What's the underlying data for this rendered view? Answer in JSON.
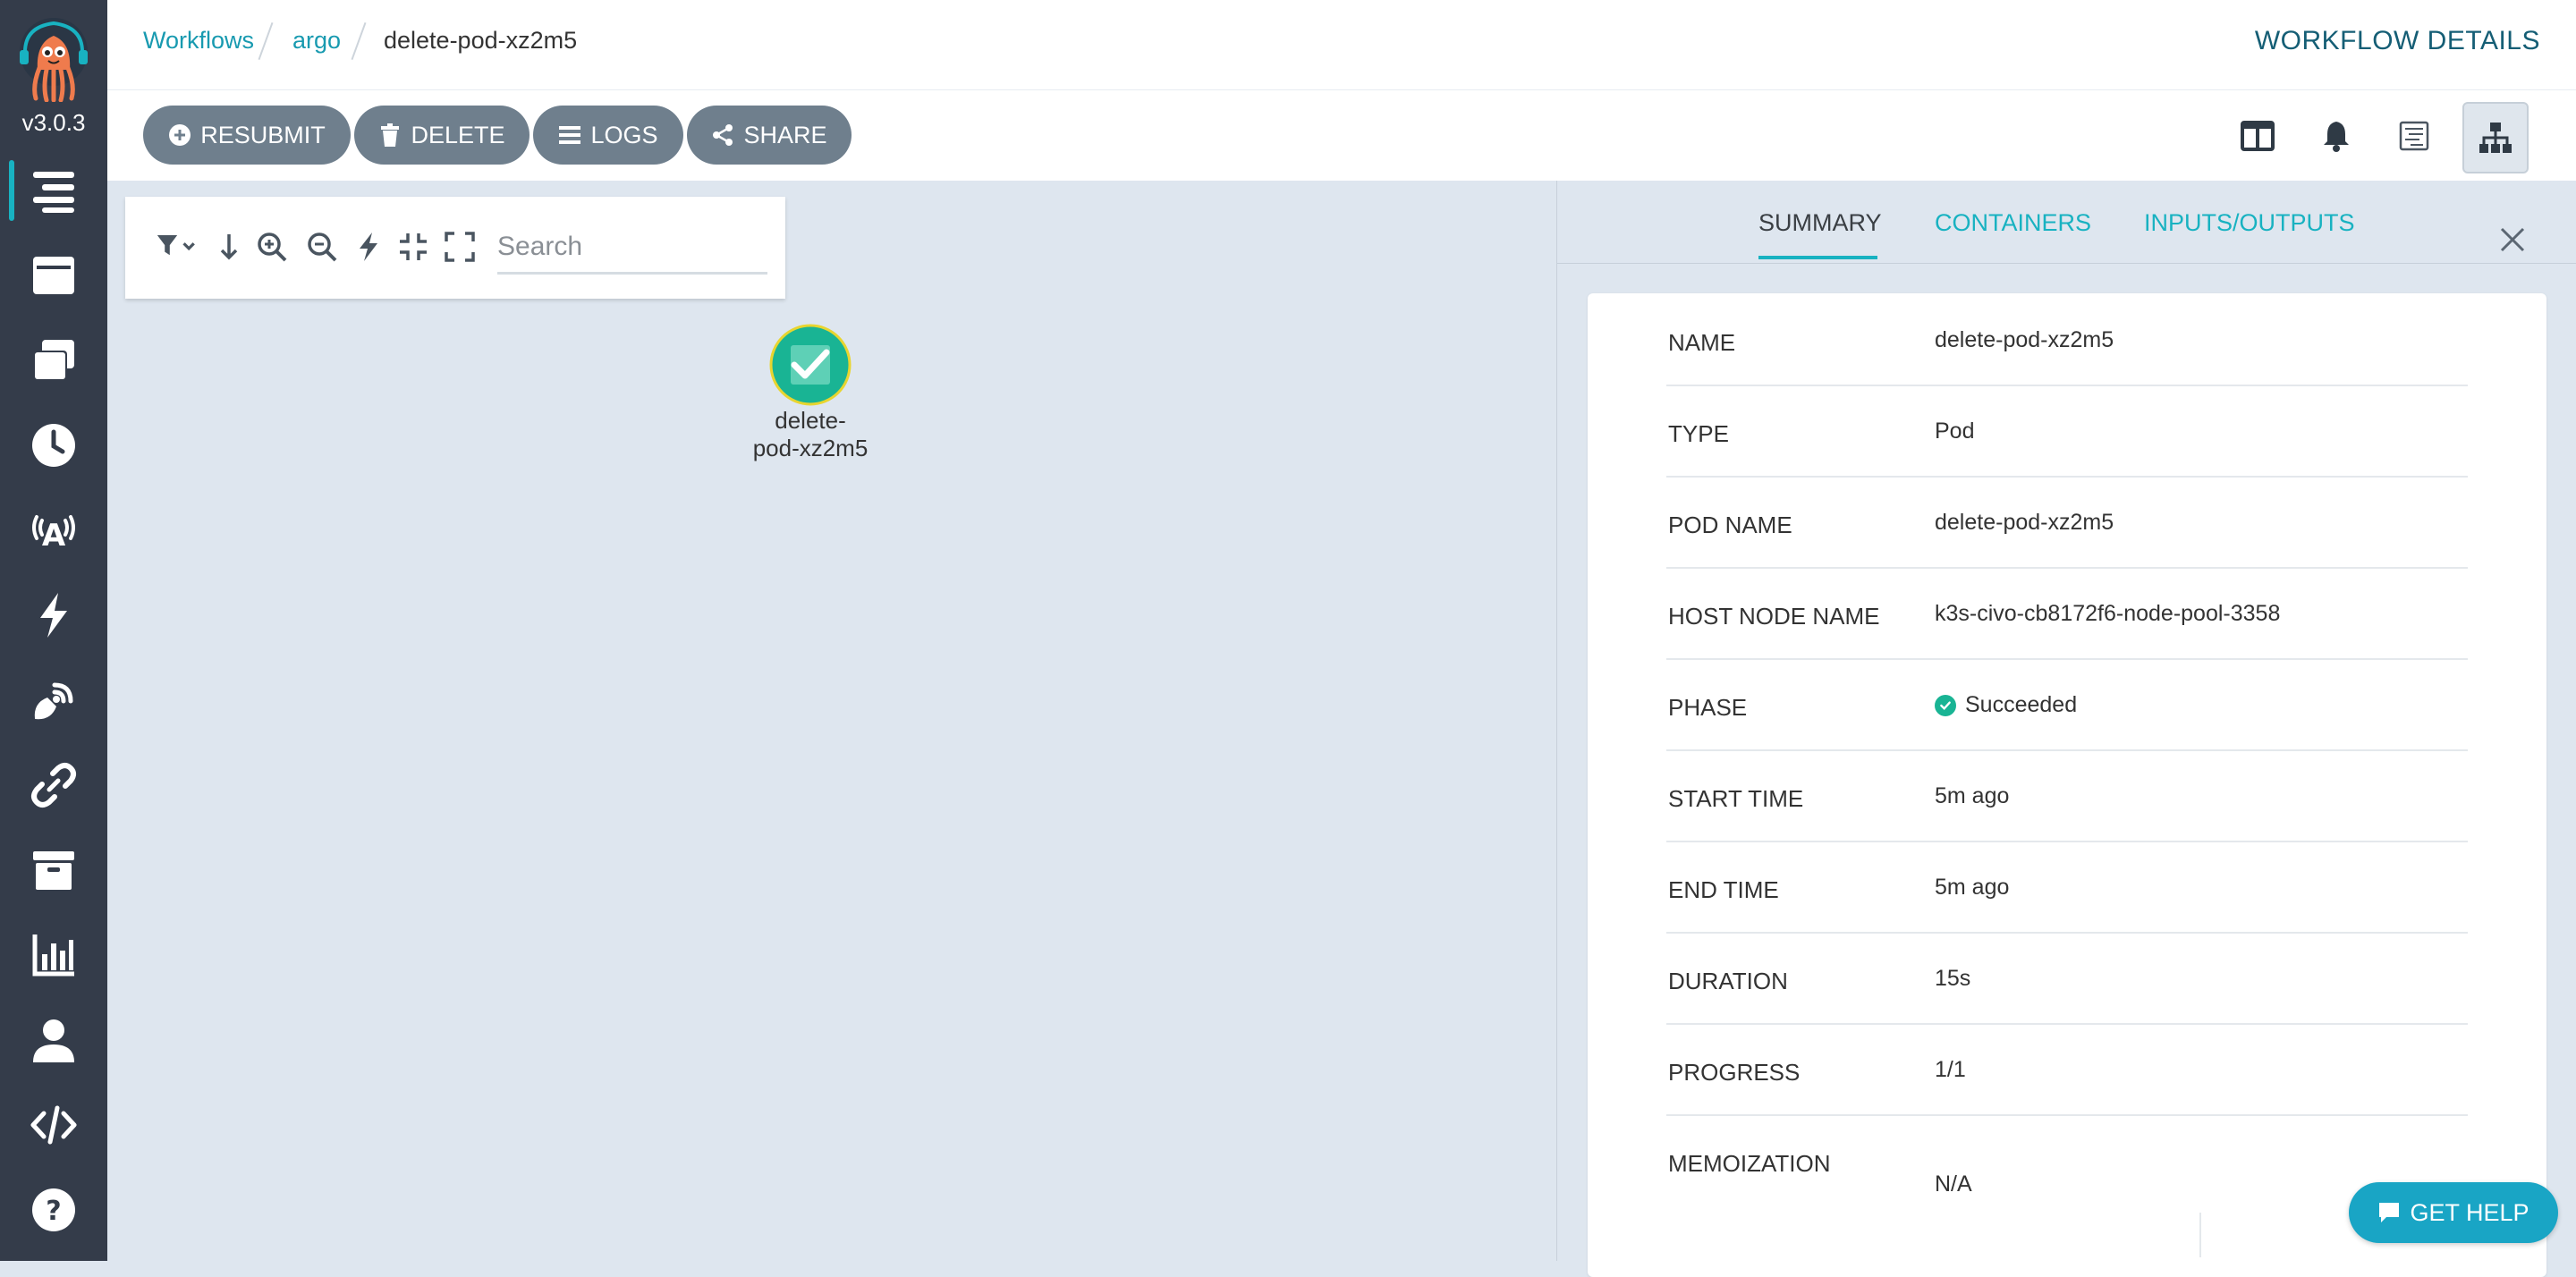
{
  "sidebar": {
    "version": "v3.0.3",
    "items": [
      {
        "icon": "workflows-icon",
        "active": true
      },
      {
        "icon": "workflow-templates-icon"
      },
      {
        "icon": "cluster-workflow-templates-icon"
      },
      {
        "icon": "cron-workflows-icon"
      },
      {
        "icon": "event-sources-icon"
      },
      {
        "icon": "sensors-icon"
      },
      {
        "icon": "event-flow-icon"
      },
      {
        "icon": "links-icon"
      },
      {
        "icon": "archived-workflows-icon"
      },
      {
        "icon": "reports-icon"
      },
      {
        "icon": "user-info-icon"
      },
      {
        "icon": "api-docs-icon"
      },
      {
        "icon": "help-icon"
      }
    ]
  },
  "breadcrumb": {
    "items": [
      "Workflows",
      "argo"
    ],
    "current": "delete-pod-xz2m5"
  },
  "page_title": "WORKFLOW DETAILS",
  "toolbar": {
    "resubmit": "RESUBMIT",
    "delete": "DELETE",
    "logs": "LOGS",
    "share": "SHARE"
  },
  "graph": {
    "search_placeholder": "Search",
    "node_label_line1": "delete-",
    "node_label_line2": "pod-xz2m5",
    "node_status_color": "#19b494"
  },
  "panel": {
    "tabs": [
      "SUMMARY",
      "CONTAINERS",
      "INPUTS/OUTPUTS"
    ],
    "active_tab": "SUMMARY",
    "rows": [
      {
        "key": "NAME",
        "value": "delete-pod-xz2m5"
      },
      {
        "key": "TYPE",
        "value": "Pod"
      },
      {
        "key": "POD NAME",
        "value": "delete-pod-xz2m5"
      },
      {
        "key": "HOST NODE NAME",
        "value": "k3s-civo-cb8172f6-node-pool-3358"
      },
      {
        "key": "PHASE",
        "value": "Succeeded"
      },
      {
        "key": "START TIME",
        "value": "5m ago"
      },
      {
        "key": "END TIME",
        "value": "5m ago"
      },
      {
        "key": "DURATION",
        "value": "15s"
      },
      {
        "key": "PROGRESS",
        "value": "1/1"
      },
      {
        "key": "MEMOIZATION",
        "value": "N/A"
      }
    ]
  },
  "help_button": "GET HELP",
  "colors": {
    "sidebar": "#343c4a",
    "accent": "#18b2c1",
    "button": "#6f7f8d",
    "success": "#19b494"
  }
}
